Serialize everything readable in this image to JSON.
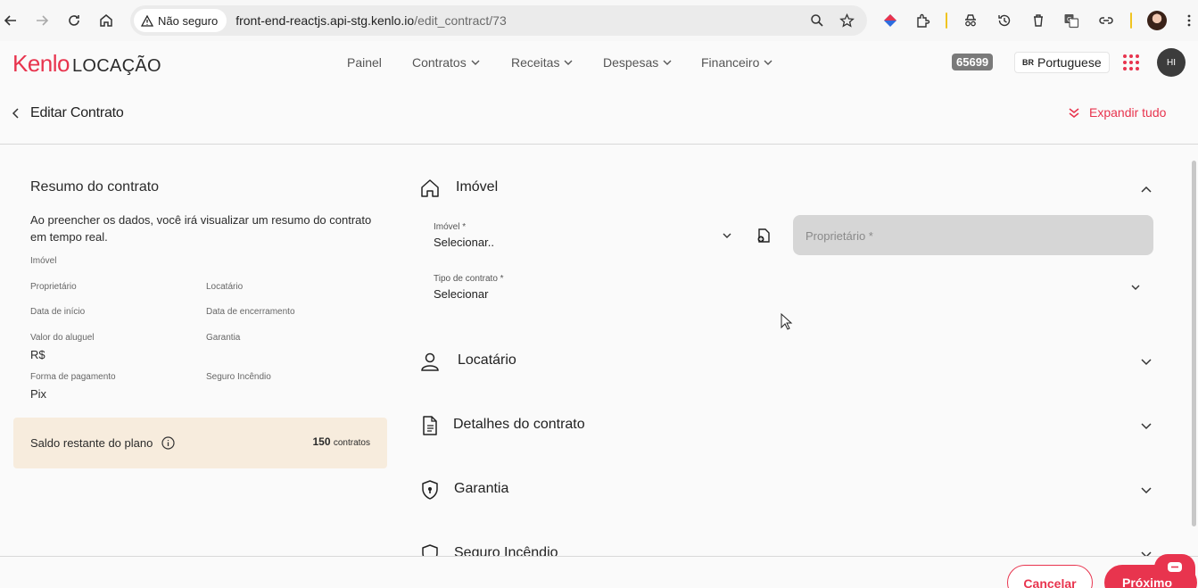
{
  "browser": {
    "security_label": "Não seguro",
    "url_host": "front-end-reactjs.api-stg.kenlo.io",
    "url_path": "/edit_contract/73"
  },
  "header": {
    "logo_brand": "Kenlo",
    "logo_product": "LOCAÇÃO",
    "nav": [
      {
        "label": "Painel"
      },
      {
        "label": "Contratos"
      },
      {
        "label": "Receitas"
      },
      {
        "label": "Despesas"
      },
      {
        "label": "Financeiro"
      }
    ],
    "account_badge": "65699",
    "language_flag": "BR",
    "language_label": "Portuguese",
    "user_initials": "HI"
  },
  "page": {
    "title": "Editar Contrato",
    "expand_all_label": "Expandir tudo"
  },
  "summary": {
    "title": "Resumo do contrato",
    "description": "Ao preencher os dados, você irá visualizar um resumo do contrato em tempo real.",
    "fields": {
      "imovel": "Imóvel",
      "proprietario": "Proprietário",
      "locatario": "Locatário",
      "data_inicio": "Data de início",
      "data_encerramento": "Data de encerramento",
      "valor_aluguel": "Valor do aluguel",
      "valor_aluguel_value": "R$",
      "garantia": "Garantia",
      "forma_pagamento": "Forma de pagamento",
      "forma_pagamento_value": "Pix",
      "seguro_incendio": "Seguro Incêndio"
    },
    "plan": {
      "label": "Saldo restante do plano",
      "count": "150",
      "unit": "contratos"
    }
  },
  "sections": {
    "imovel": {
      "title": "Imóvel",
      "imovel_label": "Imóvel *",
      "imovel_value": "Selecionar..",
      "owner_placeholder": "Proprietário *",
      "contract_type_label": "Tipo de contrato *",
      "contract_type_value": "Selecionar"
    },
    "locatario": {
      "title": "Locatário"
    },
    "detalhes": {
      "title": "Detalhes do contrato"
    },
    "garantia": {
      "title": "Garantia"
    },
    "seguro": {
      "title": "Seguro Incêndio"
    }
  },
  "footer": {
    "cancel_label": "Cancelar",
    "next_label": "Próximo"
  },
  "colors": {
    "brand": "#e8344e",
    "plan_bg": "#f7ecdd",
    "owner_input_bg": "#d6d6d6"
  }
}
